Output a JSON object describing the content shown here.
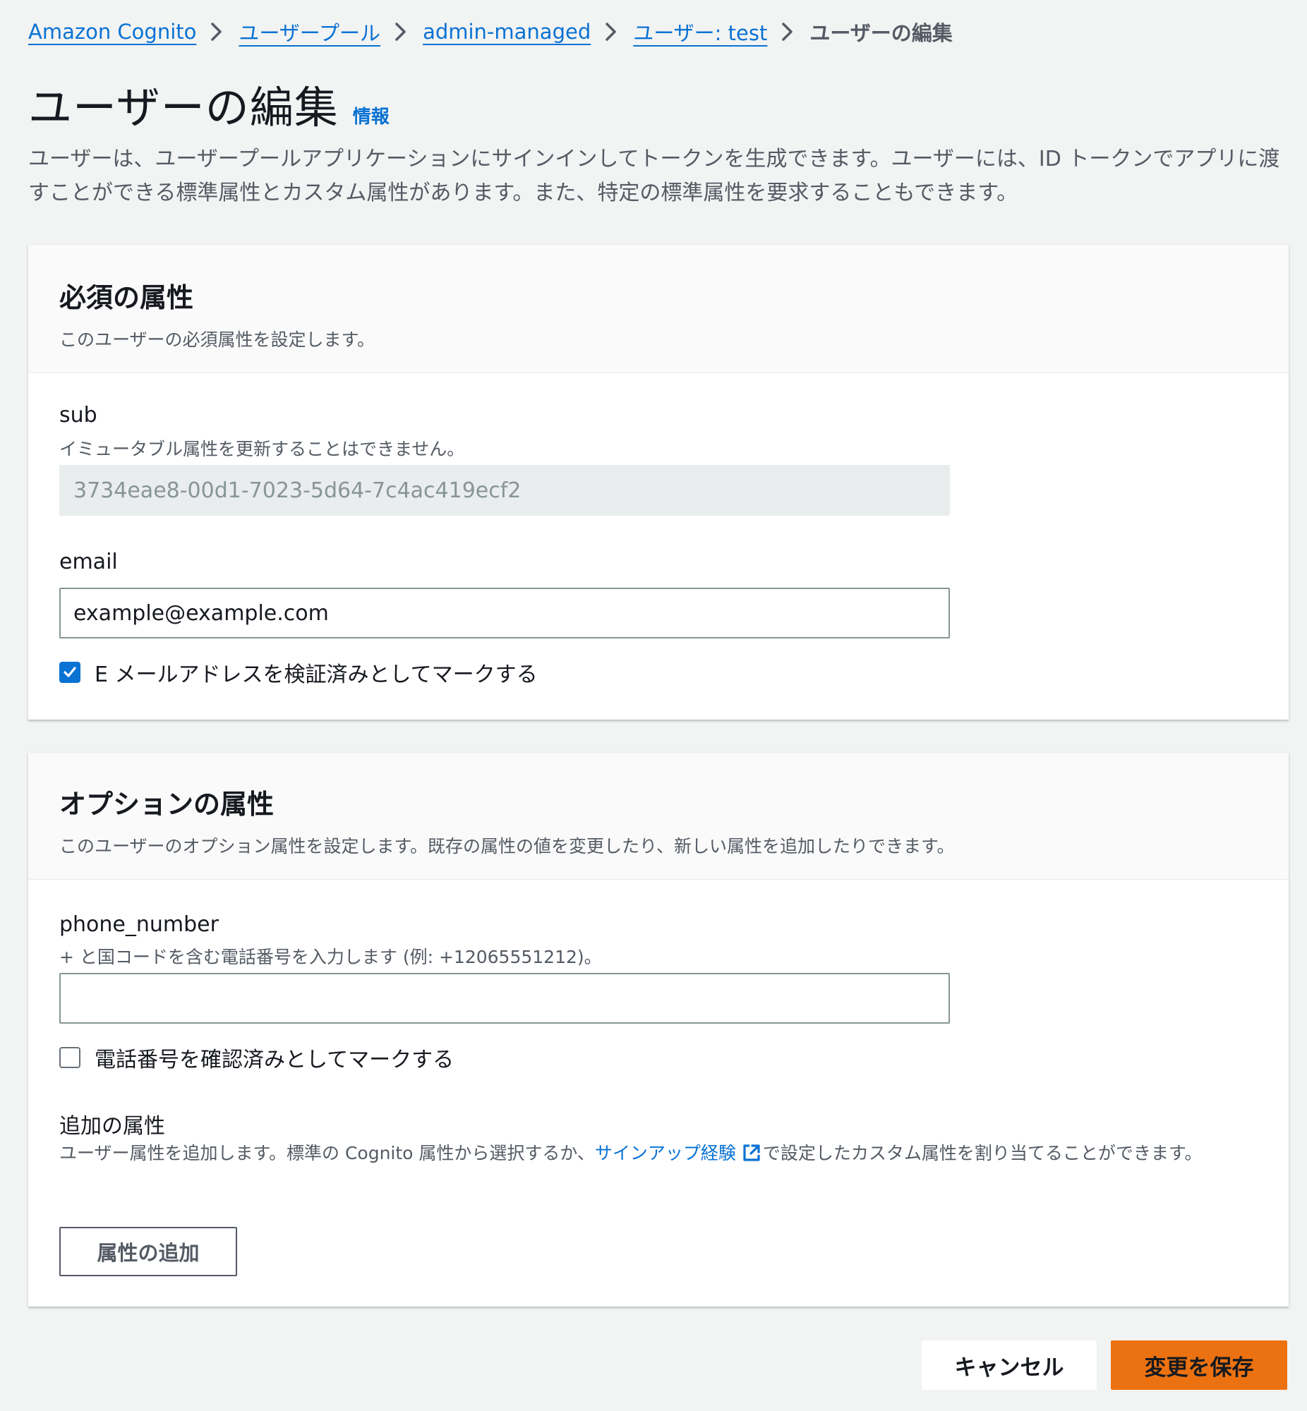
{
  "breadcrumb": {
    "items": [
      "Amazon Cognito",
      "ユーザープール",
      "admin-managed",
      "ユーザー: test"
    ],
    "current": "ユーザーの編集"
  },
  "page": {
    "title": "ユーザーの編集",
    "info_link": "情報",
    "description": "ユーザーは、ユーザープールアプリケーションにサインインしてトークンを生成できます。ユーザーには、ID トークンでアプリに渡すことができる標準属性とカスタム属性があります。また、特定の標準属性を要求することもできます。"
  },
  "required": {
    "title": "必須の属性",
    "subtitle": "このユーザーの必須属性を設定します。",
    "sub_label": "sub",
    "sub_hint": "イミュータブル属性を更新することはできません。",
    "sub_value": "3734eae8-00d1-7023-5d64-7c4ac419ecf2",
    "email_label": "email",
    "email_value": "example@example.com",
    "email_verified_label": "E メールアドレスを検証済みとしてマークする",
    "email_verified": true
  },
  "optional": {
    "title": "オプションの属性",
    "subtitle": "このユーザーのオプション属性を設定します。既存の属性の値を変更したり、新しい属性を追加したりできます。",
    "phone_label": "phone_number",
    "phone_hint": "+ と国コードを含む電話番号を入力します (例: +12065551212)。",
    "phone_value": "",
    "phone_verified_label": "電話番号を確認済みとしてマークする",
    "phone_verified": false,
    "additional_label": "追加の属性",
    "additional_desc_before": "ユーザー属性を追加します。標準の Cognito 属性から選択するか、",
    "additional_desc_link": "サインアップ経験",
    "additional_desc_after": "で設定したカスタム属性を割り当てることができます。",
    "add_button": "属性の追加"
  },
  "footer": {
    "cancel": "キャンセル",
    "save": "変更を保存"
  },
  "colors": {
    "link": "#0972d3",
    "primary_button": "#ec7211",
    "background": "#f2f3f3"
  },
  "icons": [
    "chevron-right-icon",
    "checkmark-icon",
    "external-link-icon"
  ]
}
